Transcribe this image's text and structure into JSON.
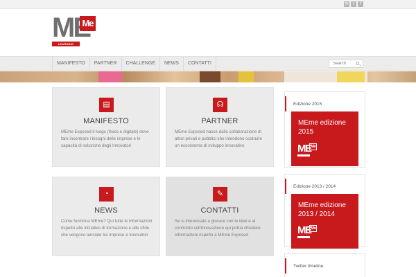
{
  "logo": {
    "main": "ME",
    "box": "Me",
    "tagline": "LEARNING EXPOSED"
  },
  "social": [
    {
      "icon": "mail-icon",
      "glyph": "✉"
    },
    {
      "icon": "twitter-icon",
      "glyph": "t"
    },
    {
      "icon": "facebook-icon",
      "glyph": "f"
    }
  ],
  "nav": {
    "items": [
      "MANIFESTO",
      "PARTNER",
      "CHALLENGE",
      "NEWS",
      "CONTATTI"
    ],
    "search_placeholder": "Search"
  },
  "cards": [
    {
      "icon": "document-icon",
      "glyph": "▤",
      "title": "MANIFESTO",
      "text": "MEme Exposed il luogo (fisico e digitale) dove fare incontrare i bisogni delle imprese e le capacità di soluzione degli Innovatori"
    },
    {
      "icon": "handshake-icon",
      "glyph": "☊",
      "title": "PARTNER",
      "text": "MEme Exposed nasce dalla collaborazione di attori privati e pubblici che intendono costruire un ecosistema di sviluppo innovativo"
    },
    {
      "icon": "megaphone-icon",
      "glyph": "◔",
      "title": "NEWS",
      "text": "Come funziona MEme? Qui tutte le informazioni rispetto alle iniziative di formazione e alle sfide che vengono lanciate tra Imprese e Innovatori"
    },
    {
      "icon": "pencil-icon",
      "glyph": "✎",
      "title": "CONTATTI",
      "text": "Se si interessato a giocare con le idee e al confronto sull'innovazione qui potrai chiedere informazioni rispetto a MEme Exposed"
    }
  ],
  "sidebar": {
    "widgets": [
      {
        "title": "Edizione 2015",
        "promo": "MEme edizione 2015"
      },
      {
        "title": "Edizione 2013 / 2014",
        "promo": "MEme edizione 2013 / 2014"
      },
      {
        "title": "Twitter timeline"
      }
    ]
  },
  "colors": {
    "brand_red": "#c8191d",
    "card_bg": "#ebebeb",
    "nav_bg": "#ececec"
  }
}
